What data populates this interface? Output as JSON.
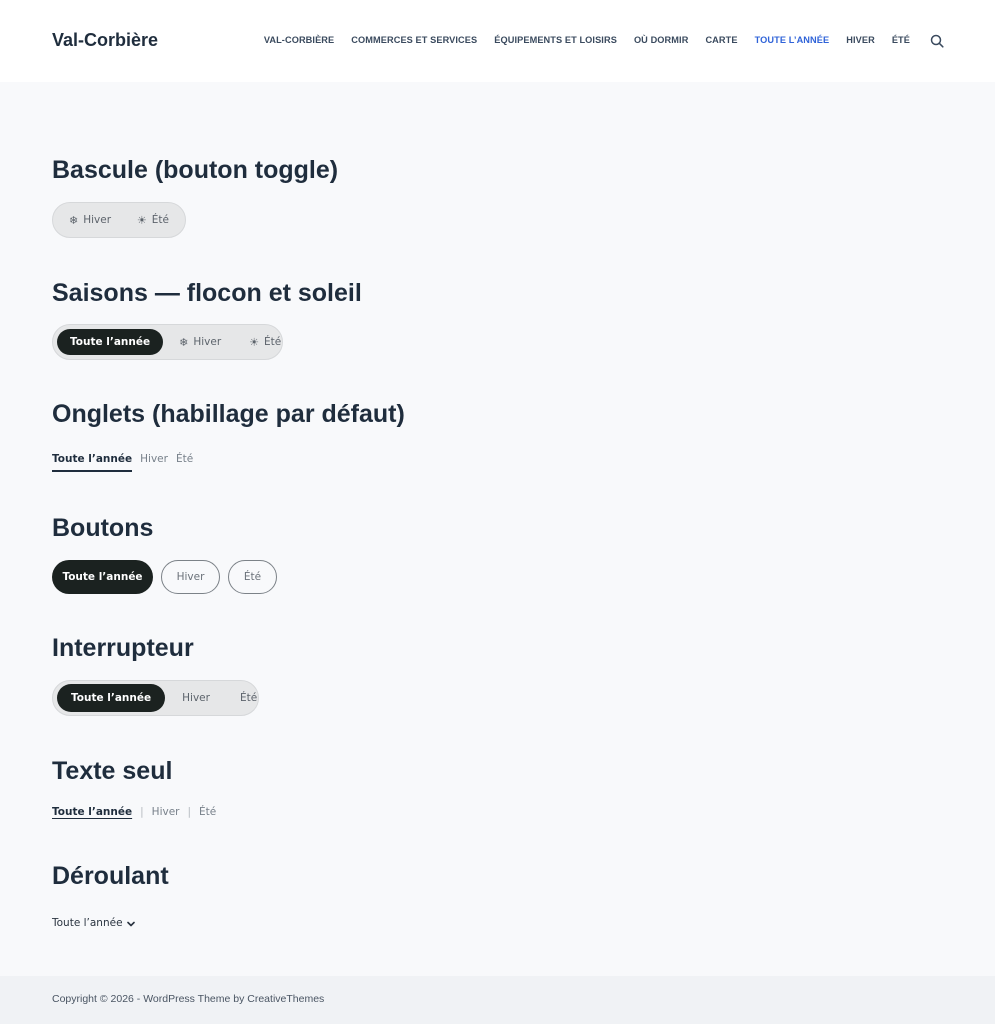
{
  "header": {
    "site_title": "Val-Corbière",
    "nav": [
      "VAL-CORBIÈRE",
      "COMMERCES ET SERVICES",
      "ÉQUIPEMENTS ET LOISIRS",
      "OÙ DORMIR",
      "CARTE",
      "TOUTE L’ANNÉE",
      "HIVER",
      "ÉTÉ"
    ],
    "active_nav": "TOUTE L’ANNÉE",
    "accent_color": "#2f63d8",
    "search_icon": "search-icon"
  },
  "sections": {
    "toggle": {
      "title": "Bascule (bouton toggle)",
      "options": [
        {
          "glyph": "❄",
          "label": "Hiver"
        },
        {
          "glyph": "☀",
          "label": "Été"
        }
      ]
    },
    "seasons": {
      "title": "Saisons — flocon et soleil",
      "active": "Toute l’année",
      "options": [
        {
          "glyph": "❄",
          "label": "Hiver"
        },
        {
          "glyph": "☀",
          "label": "Été"
        }
      ]
    },
    "tabs": {
      "title": "Onglets (habillage par défaut)",
      "options": [
        "Toute l’année",
        "Hiver",
        "Été"
      ]
    },
    "buttons": {
      "title": "Boutons",
      "options": [
        "Toute l’année",
        "Hiver",
        "Été"
      ]
    },
    "switch": {
      "title": "Interrupteur",
      "options": [
        "Toute l’année",
        "Hiver",
        "Été"
      ]
    },
    "text_only": {
      "title": "Texte seul",
      "options": [
        "Toute l’année",
        "Hiver",
        "Été"
      ],
      "separator": "|"
    },
    "dropdown": {
      "title": "Déroulant",
      "value": "Toute l’année",
      "icon": "chevron-down-icon"
    }
  },
  "footer": {
    "text": "Copyright © 2026 - WordPress Theme by CreativeThemes"
  },
  "colors": {
    "active_pill": "#1b2220",
    "pill_bg": "#e6e7e8",
    "page_bg": "#f8f9fb"
  }
}
